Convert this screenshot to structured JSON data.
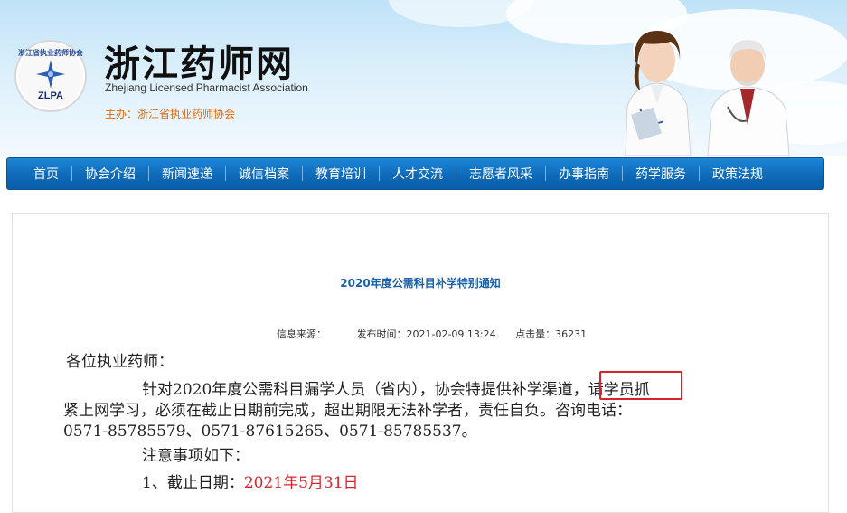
{
  "header": {
    "title": "浙江药师网",
    "subtitle": "Zhejiang Licensed Pharmacist Association",
    "host": "主办：浙江省执业药师协会",
    "logo_ring_text": "浙江省执业药师协会",
    "logo_abbr": "ZLPA"
  },
  "nav": {
    "items": [
      "首页",
      "协会介绍",
      "新闻速递",
      "诚信档案",
      "教育培训",
      "人才交流",
      "志愿者风采",
      "办事指南",
      "药学服务",
      "政策法规"
    ]
  },
  "article": {
    "title": "2020年度公需科目补学特别通知",
    "meta": {
      "source_label": "信息来源：",
      "source_value": "",
      "time_label": "发布时间：",
      "time_value": "2021-02-09 13:24",
      "hits_label": "点击量：",
      "hits_value": "36231"
    },
    "greeting": "各位执业药师：",
    "para1_a": "针对2020年度公需科目漏学人员（省内），协会特提供",
    "para1_highlight": "补学渠道",
    "para1_b": "，请学员抓",
    "para1_line2": "紧上网学习，必须在截止日期前完成，超出期限无法补学者，责任自负。咨询电话：",
    "para1_line3": "0571-85785579、0571-87615265、0571-85785537。",
    "notes_heading": "注意事项如下：",
    "deadline_label": "1、截止日期：",
    "deadline_value": "2021年5月31日"
  },
  "colors": {
    "nav_bg": "#0e6ab9",
    "title_blue": "#1a5fa8",
    "highlight_red": "#d9232c",
    "host_orange": "#e26b0d"
  }
}
